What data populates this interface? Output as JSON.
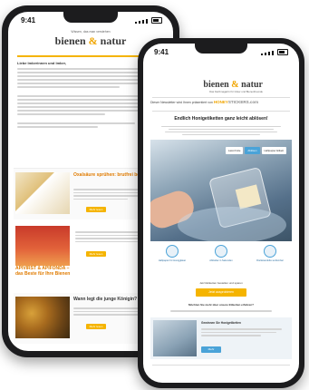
{
  "back_phone": {
    "time": "9:41",
    "brand_tag": "Wissen, das man verstehen",
    "logo_left": "bienen",
    "logo_amp": "&",
    "logo_right": "natur",
    "greeting": "Liebe Imkerinnen und Imker,",
    "articles": [
      {
        "title": "Oxalsäure sprühen: brutfrei behandeln",
        "button": "Mehr lesen"
      },
      {
        "title": "APIVIRST & APIFONDA – das Beste für Ihre Bienen",
        "button": "Mehr lesen"
      },
      {
        "title": "Wann legt die junge Königin?",
        "button": "Mehr lesen"
      }
    ]
  },
  "front_phone": {
    "time": "9:41",
    "logo_left": "bienen",
    "logo_amp": "&",
    "logo_right": "natur",
    "logo_sub": "Das Fachmagazin für Imker und Bienenfreunde",
    "sponsor_text": "Dieser Newsletter wird Ihnen präsentiert von",
    "sponsor_brand_a": "HONEY",
    "sponsor_brand_b": "STICKERS.com",
    "headline": "Endlich Honigetiketten ganz leicht ablösen!",
    "tabs": [
      "Lasst Folie",
      "Ablösen",
      "Haftpapier Etikett"
    ],
    "features": [
      "Haftpapier für Honiggläser",
      "Ablösbar in Sekunden",
      "Rückstandsfrei entfernbar"
    ],
    "cta_text": "Jetzt Etiketten bestellen und sparen",
    "cta_button": "Jetzt ausprobieren",
    "question": "Möchten Sie mehr über unsere Etiketten erfahren?",
    "promo_title": "Gewinnen Sie Honigetiketten",
    "promo_button": "Mehr"
  }
}
